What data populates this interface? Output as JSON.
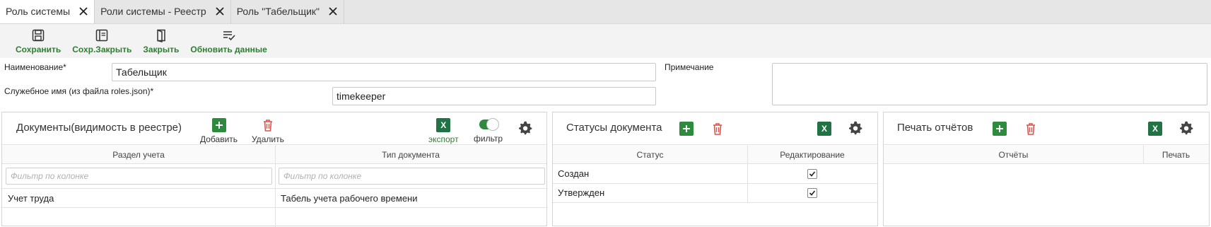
{
  "tabs": [
    {
      "label": "Роль системы"
    },
    {
      "label": "Роли системы - Реестр"
    },
    {
      "label": "Роль \"Табельщик\""
    }
  ],
  "toolbar": {
    "save": "Сохранить",
    "save_close": "Сохр.Закрыть",
    "close": "Закрыть",
    "refresh": "Обновить данные"
  },
  "form": {
    "name_label": "Наименование*",
    "name_value": "Табельщик",
    "service_label": "Служебное имя (из файла roles.json)*",
    "service_value": "timekeeper",
    "note_label": "Примечание",
    "note_value": ""
  },
  "documents": {
    "title": "Документы(видимость в реестре)",
    "add": "Добавить",
    "delete": "Удалить",
    "export": "экспорт",
    "filter": "фильтр",
    "columns": [
      "Раздел учета",
      "Тип документа"
    ],
    "filter_placeholder": "Фильтр по колонке",
    "rows": [
      {
        "section": "Учет труда",
        "doc_type": "Табель учета рабочего времени"
      }
    ]
  },
  "statuses": {
    "title": "Статусы документа",
    "columns": [
      "Статус",
      "Редактирование"
    ],
    "rows": [
      {
        "status": "Создан",
        "editable": true
      },
      {
        "status": "Утвержден",
        "editable": true
      }
    ]
  },
  "reports": {
    "title": "Печать отчётов",
    "columns": [
      "Отчёты",
      "Печать"
    ],
    "rows": []
  },
  "colors": {
    "accent_green": "#2e8b3e",
    "delete_red": "#d9534f",
    "excel_green": "#217346"
  }
}
